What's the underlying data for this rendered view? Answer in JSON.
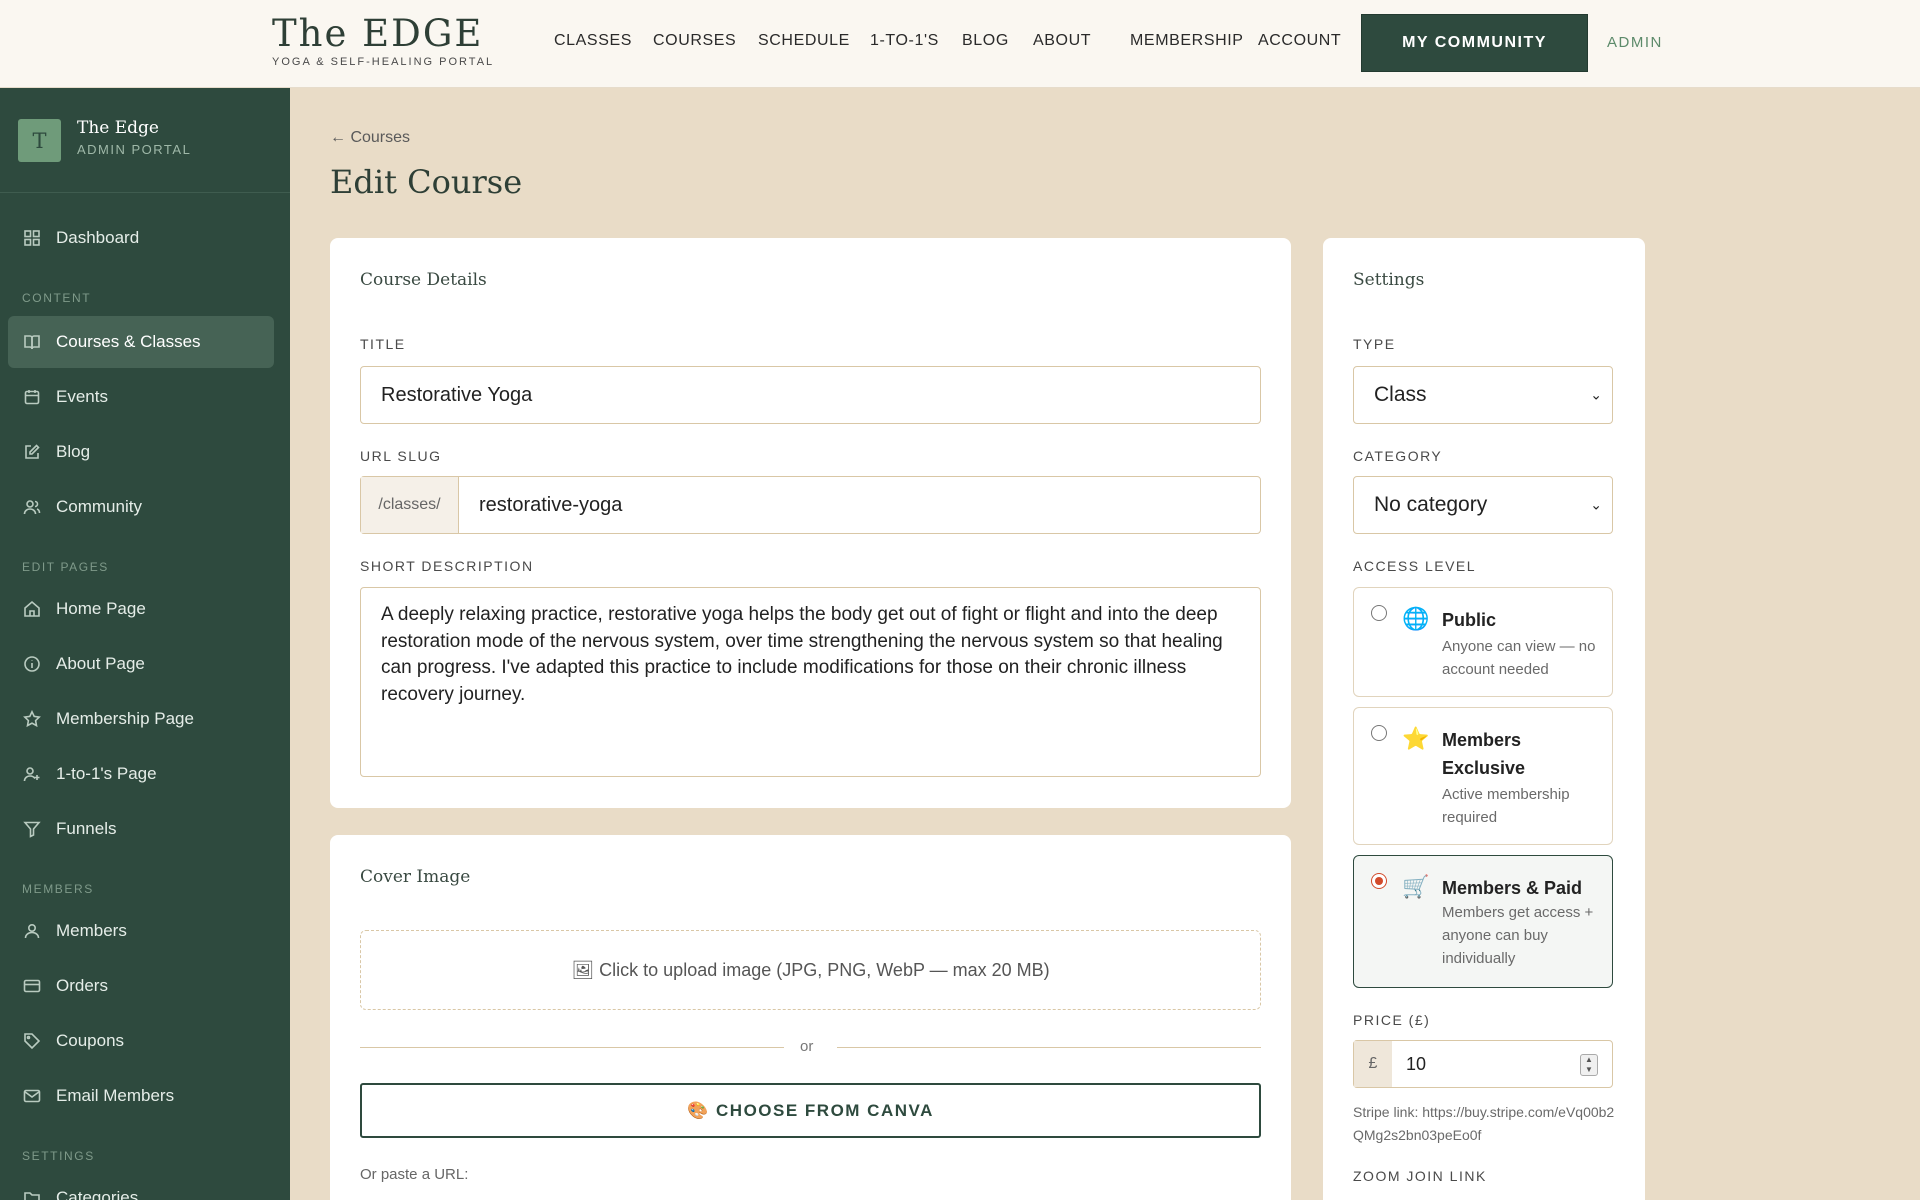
{
  "site": {
    "logo_name": "The EDGE",
    "logo_tagline": "YOGA & SELF-HEALING PORTAL",
    "nav": [
      "CLASSES",
      "COURSES",
      "SCHEDULE",
      "1-TO-1'S",
      "BLOG",
      "ABOUT",
      "MEMBERSHIP",
      "ACCOUNT"
    ],
    "community_button": "MY COMMUNITY",
    "admin_link": "ADMIN"
  },
  "sidebar": {
    "avatar_letter": "T",
    "brand_name": "The Edge",
    "brand_sub": "ADMIN PORTAL",
    "items": [
      {
        "label": "Dashboard",
        "icon": "grid-icon"
      },
      {
        "label": "Courses & Classes",
        "icon": "book-icon"
      },
      {
        "label": "Events",
        "icon": "calendar-icon"
      },
      {
        "label": "Blog",
        "icon": "edit-icon"
      },
      {
        "label": "Community",
        "icon": "users-icon"
      },
      {
        "label": "Home Page",
        "icon": "home-icon"
      },
      {
        "label": "About Page",
        "icon": "info-icon"
      },
      {
        "label": "Membership Page",
        "icon": "star-icon"
      },
      {
        "label": "1-to-1's Page",
        "icon": "user-plus-icon"
      },
      {
        "label": "Funnels",
        "icon": "filter-icon"
      },
      {
        "label": "Members",
        "icon": "user-icon"
      },
      {
        "label": "Orders",
        "icon": "card-icon"
      },
      {
        "label": "Coupons",
        "icon": "tag-icon"
      },
      {
        "label": "Email Members",
        "icon": "mail-icon"
      },
      {
        "label": "Categories",
        "icon": "folder-icon"
      }
    ],
    "sections": {
      "content": "CONTENT",
      "edit_pages": "EDIT PAGES",
      "members": "MEMBERS",
      "settings": "SETTINGS"
    }
  },
  "page": {
    "back_link": "← Courses",
    "title": "Edit Course"
  },
  "details": {
    "card_title": "Course Details",
    "title_label": "TITLE",
    "title_value": "Restorative Yoga",
    "slug_label": "URL SLUG",
    "slug_prefix": "/classes/",
    "slug_value": "restorative-yoga",
    "desc_label": "SHORT DESCRIPTION",
    "desc_value": "A deeply relaxing practice, restorative yoga helps the body get out of fight or flight and into the deep restoration mode of the nervous system, over time strengthening the nervous system so that healing can progress. I've adapted this practice to include modifications for those on their chronic illness recovery journey."
  },
  "cover": {
    "card_title": "Cover Image",
    "upload_text": "🖼 Click to upload image (JPG, PNG, WebP — max 20 MB)",
    "or_text": "or",
    "canva_button": "🎨 CHOOSE FROM CANVA",
    "paste_label": "Or paste a URL:"
  },
  "settings": {
    "card_title": "Settings",
    "type_label": "TYPE",
    "type_value": "Class",
    "category_label": "CATEGORY",
    "category_value": "No category",
    "access_label": "ACCESS LEVEL",
    "access_options": [
      {
        "emoji": "🌐",
        "title": "Public",
        "desc": "Anyone can view — no account needed",
        "selected": false
      },
      {
        "emoji": "⭐",
        "title": "Members Exclusive",
        "desc": "Active membership required",
        "selected": false
      },
      {
        "emoji": "🛒",
        "title": "Members & Paid",
        "desc": "Members get access + anyone can buy individually",
        "selected": true
      }
    ],
    "price_label": "PRICE (£)",
    "price_currency": "£",
    "price_value": "10",
    "stripe_text": "Stripe link: https://buy.stripe.com/eVq00b2QMg2s2bn03peEo0f",
    "zoom_label": "ZOOM JOIN LINK"
  },
  "colors": {
    "brand_green": "#2e4a3e",
    "background": "#e9dcc7",
    "accent_red": "#d24b2b"
  }
}
